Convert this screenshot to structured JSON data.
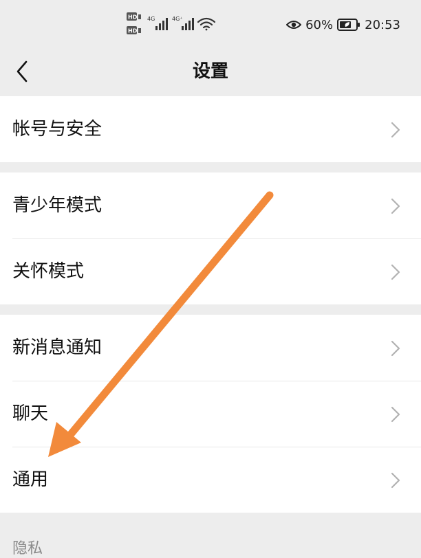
{
  "status_bar": {
    "eye_icon": "eye-icon",
    "battery_percent": "60%",
    "time": "20:53",
    "signal_1_label": "4G",
    "signal_2_label": "4G⁺",
    "hd_label": "HD"
  },
  "nav": {
    "title": "设置"
  },
  "groups": [
    {
      "items": [
        {
          "label": "帐号与安全"
        }
      ]
    },
    {
      "items": [
        {
          "label": "青少年模式"
        },
        {
          "label": "关怀模式"
        }
      ]
    },
    {
      "items": [
        {
          "label": "新消息通知"
        },
        {
          "label": "聊天"
        },
        {
          "label": "通用"
        }
      ]
    }
  ],
  "footer": {
    "section_label": "隐私"
  },
  "colors": {
    "background": "#ededed",
    "row_background": "#ffffff",
    "annotation_arrow": "#f28a3b"
  }
}
